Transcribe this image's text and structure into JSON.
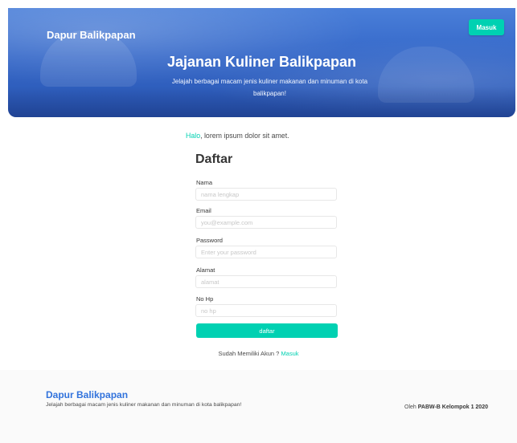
{
  "header": {
    "brand": "Dapur Balikpapan",
    "login_button": "Masuk",
    "hero_title": "Jajanan Kuliner Balikpapan",
    "hero_subtitle": "Jelajah berbagai macam jenis kuliner makanan dan minuman di kota balikpapan!"
  },
  "form": {
    "greeting_highlight": "Halo",
    "greeting_rest": ", lorem ipsum dolor sit amet.",
    "title": "Daftar",
    "fields": [
      {
        "label": "Nama",
        "placeholder": "nama lengkap"
      },
      {
        "label": "Email",
        "placeholder": "you@example.com"
      },
      {
        "label": "Password",
        "placeholder": "Enter your password"
      },
      {
        "label": "Alamat",
        "placeholder": "alamat"
      },
      {
        "label": "No Hp",
        "placeholder": "no hp"
      }
    ],
    "submit_label": "daftar",
    "signin_prompt": "Sudah Memiliki Akun ? ",
    "signin_link": "Masuk"
  },
  "footer": {
    "brand": "Dapur Balikpapan",
    "subtitle": "Jelajah berbagai macam jenis kuliner makanan dan minuman di kota balikpapan!",
    "credit_prefix": "Oleh ",
    "credit_strong": "PABW-B Kelompok 1 2020"
  },
  "colors": {
    "accent": "#00d1b2",
    "hero": "#3467c8",
    "footer_brand": "#3273dc"
  }
}
